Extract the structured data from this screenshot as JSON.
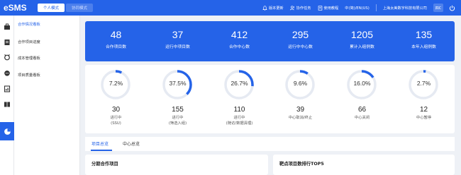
{
  "app": {
    "logo": "eSMS"
  },
  "modes": {
    "personal": "个人模式",
    "collab": "协同模式"
  },
  "topbar": {
    "version_update": "版本更新",
    "collab_tasks": "协作任务",
    "tutorial": "使用教程",
    "language": "中(简)/EN(US)",
    "company": "上海太美数字科技有限公司",
    "avatar_text": "四C"
  },
  "subnav": {
    "items": [
      "合作情况看板",
      "合作项目进度",
      "成本管理看板",
      "项目质量看板"
    ]
  },
  "banner_stats": [
    {
      "value": "48",
      "label": "合作项目数"
    },
    {
      "value": "37",
      "label": "运行中项目数"
    },
    {
      "value": "412",
      "label": "合作中心数"
    },
    {
      "value": "295",
      "label": "运行中中心数"
    },
    {
      "value": "1205",
      "label": "累计入组例数"
    },
    {
      "value": "135",
      "label": "本年入组例数"
    }
  ],
  "gauges": [
    {
      "pct_text": "7.2%",
      "pct": 7.2,
      "count": "30",
      "label1": "进行中",
      "label2": "(SSU)"
    },
    {
      "pct_text": "37.5%",
      "pct": 37.5,
      "count": "155",
      "label1": "进行中",
      "label2": "(筛选入组)"
    },
    {
      "pct_text": "26.7%",
      "pct": 26.7,
      "count": "110",
      "label1": "进行中",
      "label2": "(随访/数据清理)"
    },
    {
      "pct_text": "9.6%",
      "pct": 9.6,
      "count": "39",
      "label1": "中心取消/终止",
      "label2": ""
    },
    {
      "pct_text": "16.0%",
      "pct": 16.0,
      "count": "66",
      "label1": "中心关闭",
      "label2": ""
    },
    {
      "pct_text": "2.7%",
      "pct": 2.7,
      "count": "12",
      "label1": "中心暂停",
      "label2": ""
    }
  ],
  "tabs": {
    "project_overview": "项目总览",
    "center_overview": "中心总览"
  },
  "panels": {
    "phase_projects": "分期合作项目",
    "top5": "靶点项目数排行TOP5"
  },
  "colors": {
    "accent": "#2563e8",
    "track": "#e6eaf2"
  }
}
